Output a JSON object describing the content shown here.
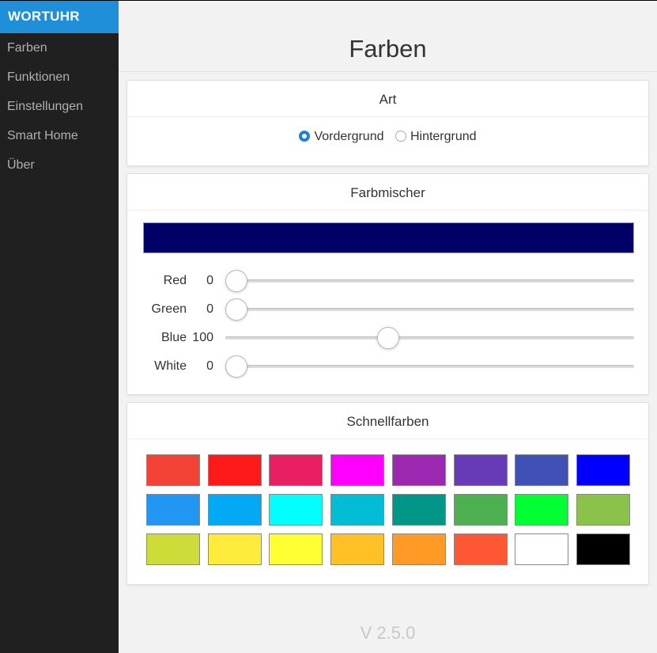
{
  "app": {
    "brand": "WORTUHR"
  },
  "sidebar": {
    "items": [
      {
        "label": "Farben"
      },
      {
        "label": "Funktionen"
      },
      {
        "label": "Einstellungen"
      },
      {
        "label": "Smart Home"
      },
      {
        "label": "Über"
      }
    ]
  },
  "page": {
    "title": "Farben",
    "version": "V 2.5.0"
  },
  "art": {
    "title": "Art",
    "options": [
      {
        "label": "Vordergrund",
        "selected": true
      },
      {
        "label": "Hintergrund",
        "selected": false
      }
    ]
  },
  "mixer": {
    "title": "Farbmischer",
    "preview_color": "#000066",
    "max": 255,
    "sliders": [
      {
        "label": "Red",
        "value": "0"
      },
      {
        "label": "Green",
        "value": "0"
      },
      {
        "label": "Blue",
        "value": "100"
      },
      {
        "label": "White",
        "value": "0"
      }
    ]
  },
  "quick": {
    "title": "Schnellfarben",
    "colors": [
      "#f44336",
      "#ff1a1a",
      "#e91e63",
      "#ff00ff",
      "#9c27b0",
      "#673ab7",
      "#3f51b5",
      "#0000ff",
      "#2196f3",
      "#03a9f4",
      "#00ffff",
      "#00bcd4",
      "#009688",
      "#4caf50",
      "#00ff33",
      "#8bc34a",
      "#cddc39",
      "#ffeb3b",
      "#ffff33",
      "#ffc125",
      "#ff9a26",
      "#ff5733",
      "#ffffff",
      "#000000"
    ]
  }
}
